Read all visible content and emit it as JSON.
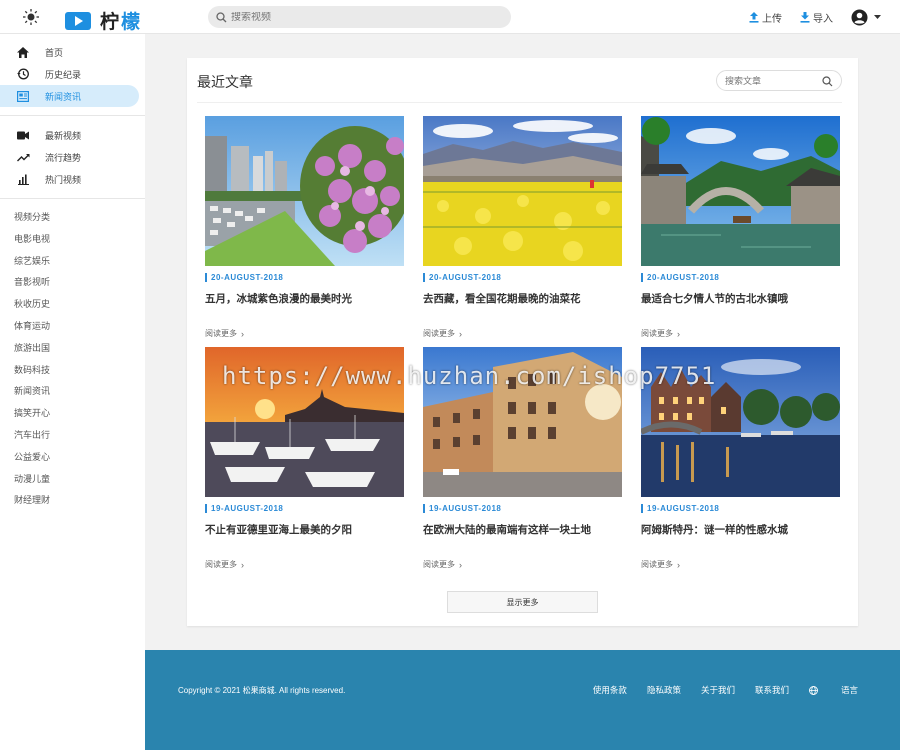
{
  "header": {
    "brand_part1": "柠",
    "brand_part2": "檬",
    "search_placeholder": "搜索视频",
    "upload_label": "上传",
    "import_label": "导入"
  },
  "sidebar": {
    "nav": [
      {
        "label": "首页",
        "icon": "home-icon"
      },
      {
        "label": "历史纪录",
        "icon": "history-icon"
      },
      {
        "label": "新闻资讯",
        "icon": "news-icon",
        "active": true
      }
    ],
    "nav2": [
      {
        "label": "最新视频",
        "icon": "video-camera-icon"
      },
      {
        "label": "流行趋势",
        "icon": "trending-icon"
      },
      {
        "label": "热门视频",
        "icon": "bar-chart-icon"
      }
    ],
    "categories_title": "视频分类",
    "categories": [
      "电影电视",
      "综艺娱乐",
      "音影视听",
      "秋收历史",
      "体育运动",
      "旅游出国",
      "数码科技",
      "新闻资讯",
      "搞笑开心",
      "汽车出行",
      "公益爱心",
      "动漫儿童",
      "财经理财"
    ]
  },
  "main": {
    "title": "最近文章",
    "search_placeholder": "搜索文章",
    "read_more_label": "阅读更多",
    "show_more_label": "显示更多",
    "articles": [
      {
        "date": "20-AUGUST-2018",
        "title": "五月，冰城紫色浪漫的最美时光"
      },
      {
        "date": "20-AUGUST-2018",
        "title": "去西藏，看全国花期最晚的油菜花"
      },
      {
        "date": "20-AUGUST-2018",
        "title": "最适合七夕情人节的古北水镇哦"
      },
      {
        "date": "19-AUGUST-2018",
        "title": "不止有亚德里亚海上最美的夕阳"
      },
      {
        "date": "19-AUGUST-2018",
        "title": "在欧洲大陆的最南端有这样一块土地"
      },
      {
        "date": "19-AUGUST-2018",
        "title": "阿姆斯特丹：谜一样的性感水城"
      }
    ]
  },
  "footer": {
    "copyright": "Copyright © 2021 松果商城. All rights reserved.",
    "links": [
      "使用条款",
      "隐私政策",
      "关于我们",
      "联系我们"
    ],
    "language_label": "语言"
  },
  "watermark": "https://www.huzhan.com/ishop7751",
  "colors": {
    "accent": "#1e8fe0",
    "footer": "#2a84ae",
    "date": "#2b8ad6"
  }
}
